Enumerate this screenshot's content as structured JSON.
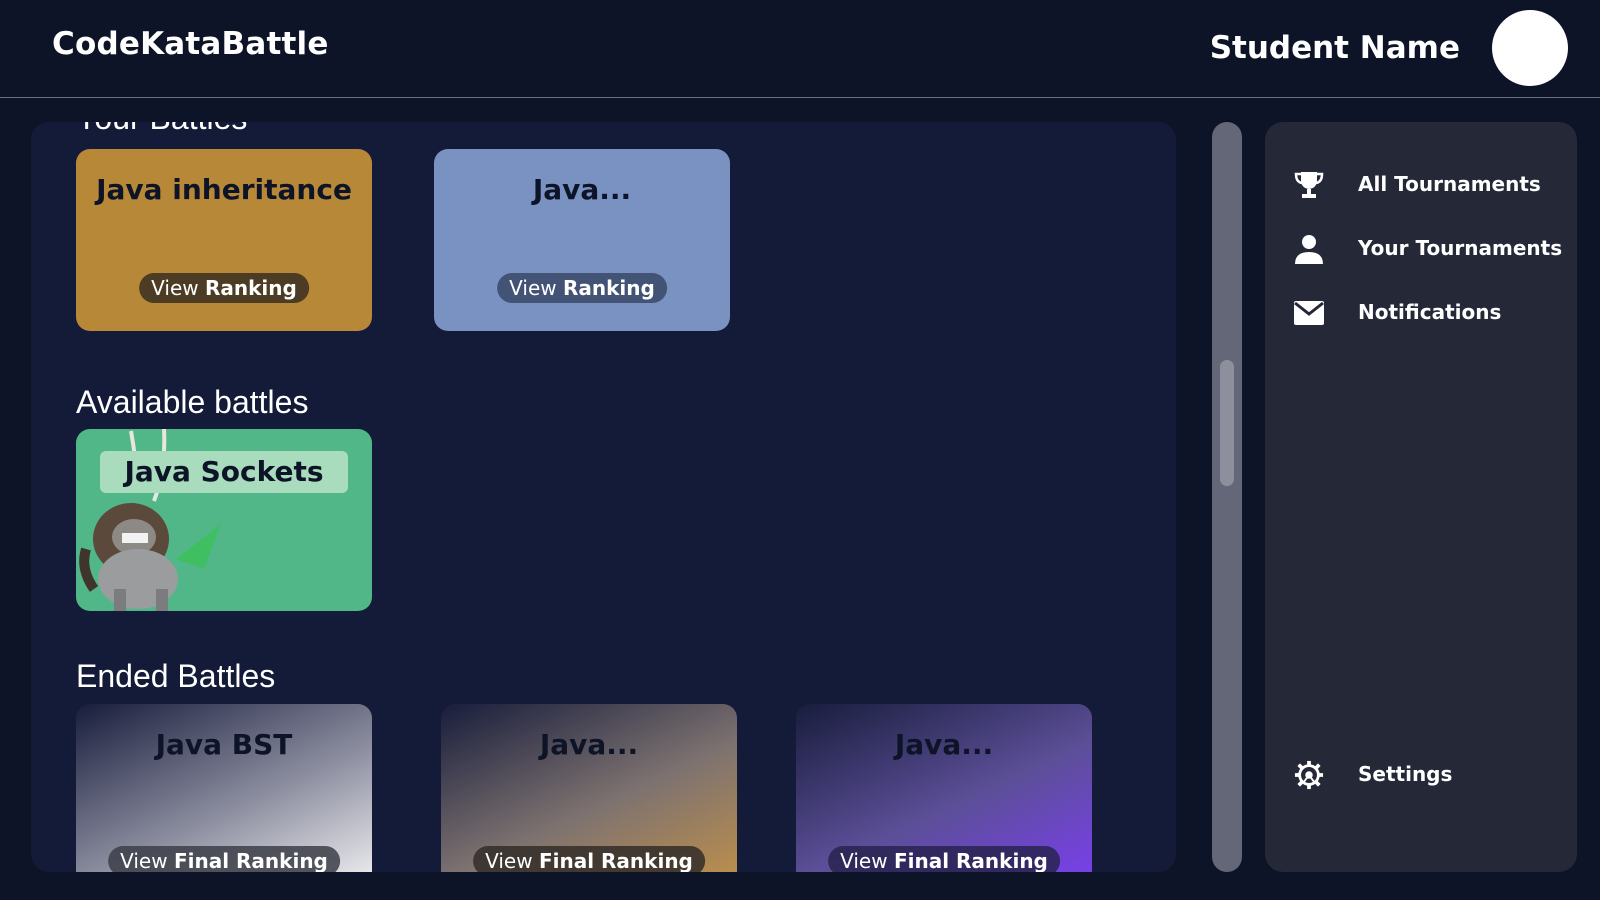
{
  "header": {
    "brand": "CodeKataBattle",
    "student_name": "Student Name"
  },
  "sections": {
    "your_battles": "Your Battles",
    "available": "Available battles",
    "ended": "Ended Battles"
  },
  "your_battles": [
    {
      "title": "Java inheritance",
      "pill_prefix": "View",
      "pill_strong": "Ranking",
      "color": "#b78838"
    },
    {
      "title": "Java...",
      "pill_prefix": "View",
      "pill_strong": "Ranking",
      "color": "#7992c2"
    }
  ],
  "available_battles": [
    {
      "title": "Java Sockets",
      "color": "#52b788"
    }
  ],
  "ended_battles": [
    {
      "title": "Java BST",
      "pill_prefix": "View",
      "pill_strong": "Final Ranking"
    },
    {
      "title": "Java...",
      "pill_prefix": "View",
      "pill_strong": "Final Ranking"
    },
    {
      "title": "Java...",
      "pill_prefix": "View",
      "pill_strong": "Final Ranking"
    }
  ],
  "sidebar": {
    "items": [
      {
        "label": "All Tournaments",
        "icon": "trophy-icon"
      },
      {
        "label": "Your Tournaments",
        "icon": "person-icon"
      },
      {
        "label": "Notifications",
        "icon": "mail-icon"
      }
    ],
    "settings": {
      "label": "Settings",
      "icon": "gear-icon"
    }
  },
  "colors": {
    "background": "#0e1427",
    "panel": "#141b38",
    "sidebar": "#242837",
    "scrollbar": "#646777"
  }
}
